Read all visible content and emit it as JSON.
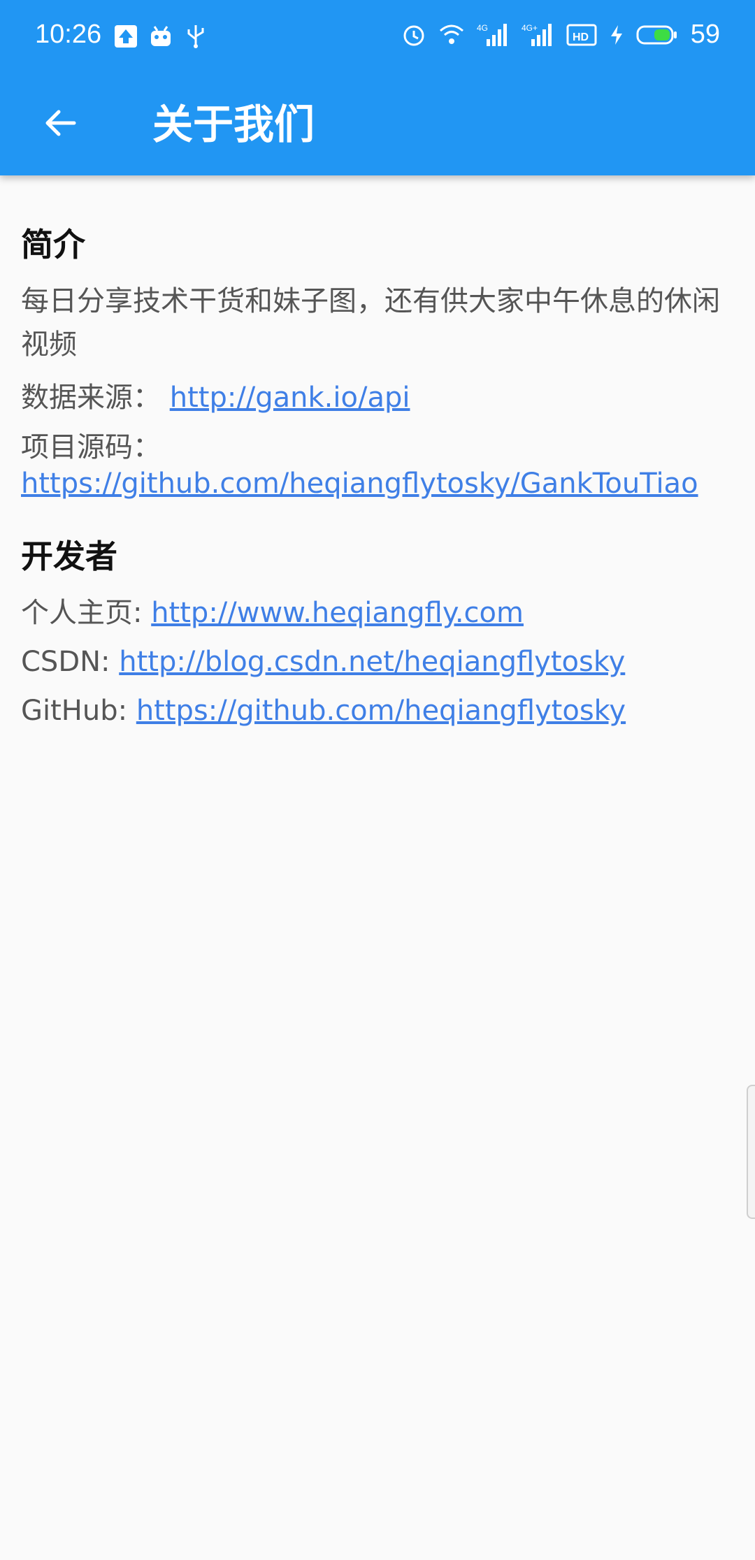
{
  "status_bar": {
    "time": "10:26",
    "battery": "59",
    "left_icons": [
      "upload-icon",
      "android-icon",
      "usb-icon"
    ],
    "right_icons": [
      "alarm-icon",
      "wifi-icon",
      "signal-4g-icon",
      "signal-4g-plus-icon",
      "hd-icon",
      "charging-icon",
      "battery-icon"
    ]
  },
  "app_bar": {
    "title": "关于我们",
    "back_icon": "arrow-back-icon"
  },
  "intro": {
    "heading": "简介",
    "description": "每日分享技术干货和妹子图，还有供大家中午休息的休闲视频",
    "data_source_label": "数据来源：",
    "data_source_url": "http://gank.io/api",
    "project_source_label": "项目源码：",
    "project_source_url": "https://github.com/heqiangflytosky/GankTouTiao"
  },
  "developer": {
    "heading": "开发者",
    "homepage_label": "个人主页: ",
    "homepage_url": "http://www.heqiangfly.com",
    "csdn_label": "CSDN: ",
    "csdn_url": "http://blog.csdn.net/heqiangflytosky",
    "github_label": "GitHub: ",
    "github_url": "https://github.com/heqiangflytosky"
  },
  "colors": {
    "primary": "#2196F3",
    "link": "#3F7FE6",
    "background": "#fafafa"
  }
}
